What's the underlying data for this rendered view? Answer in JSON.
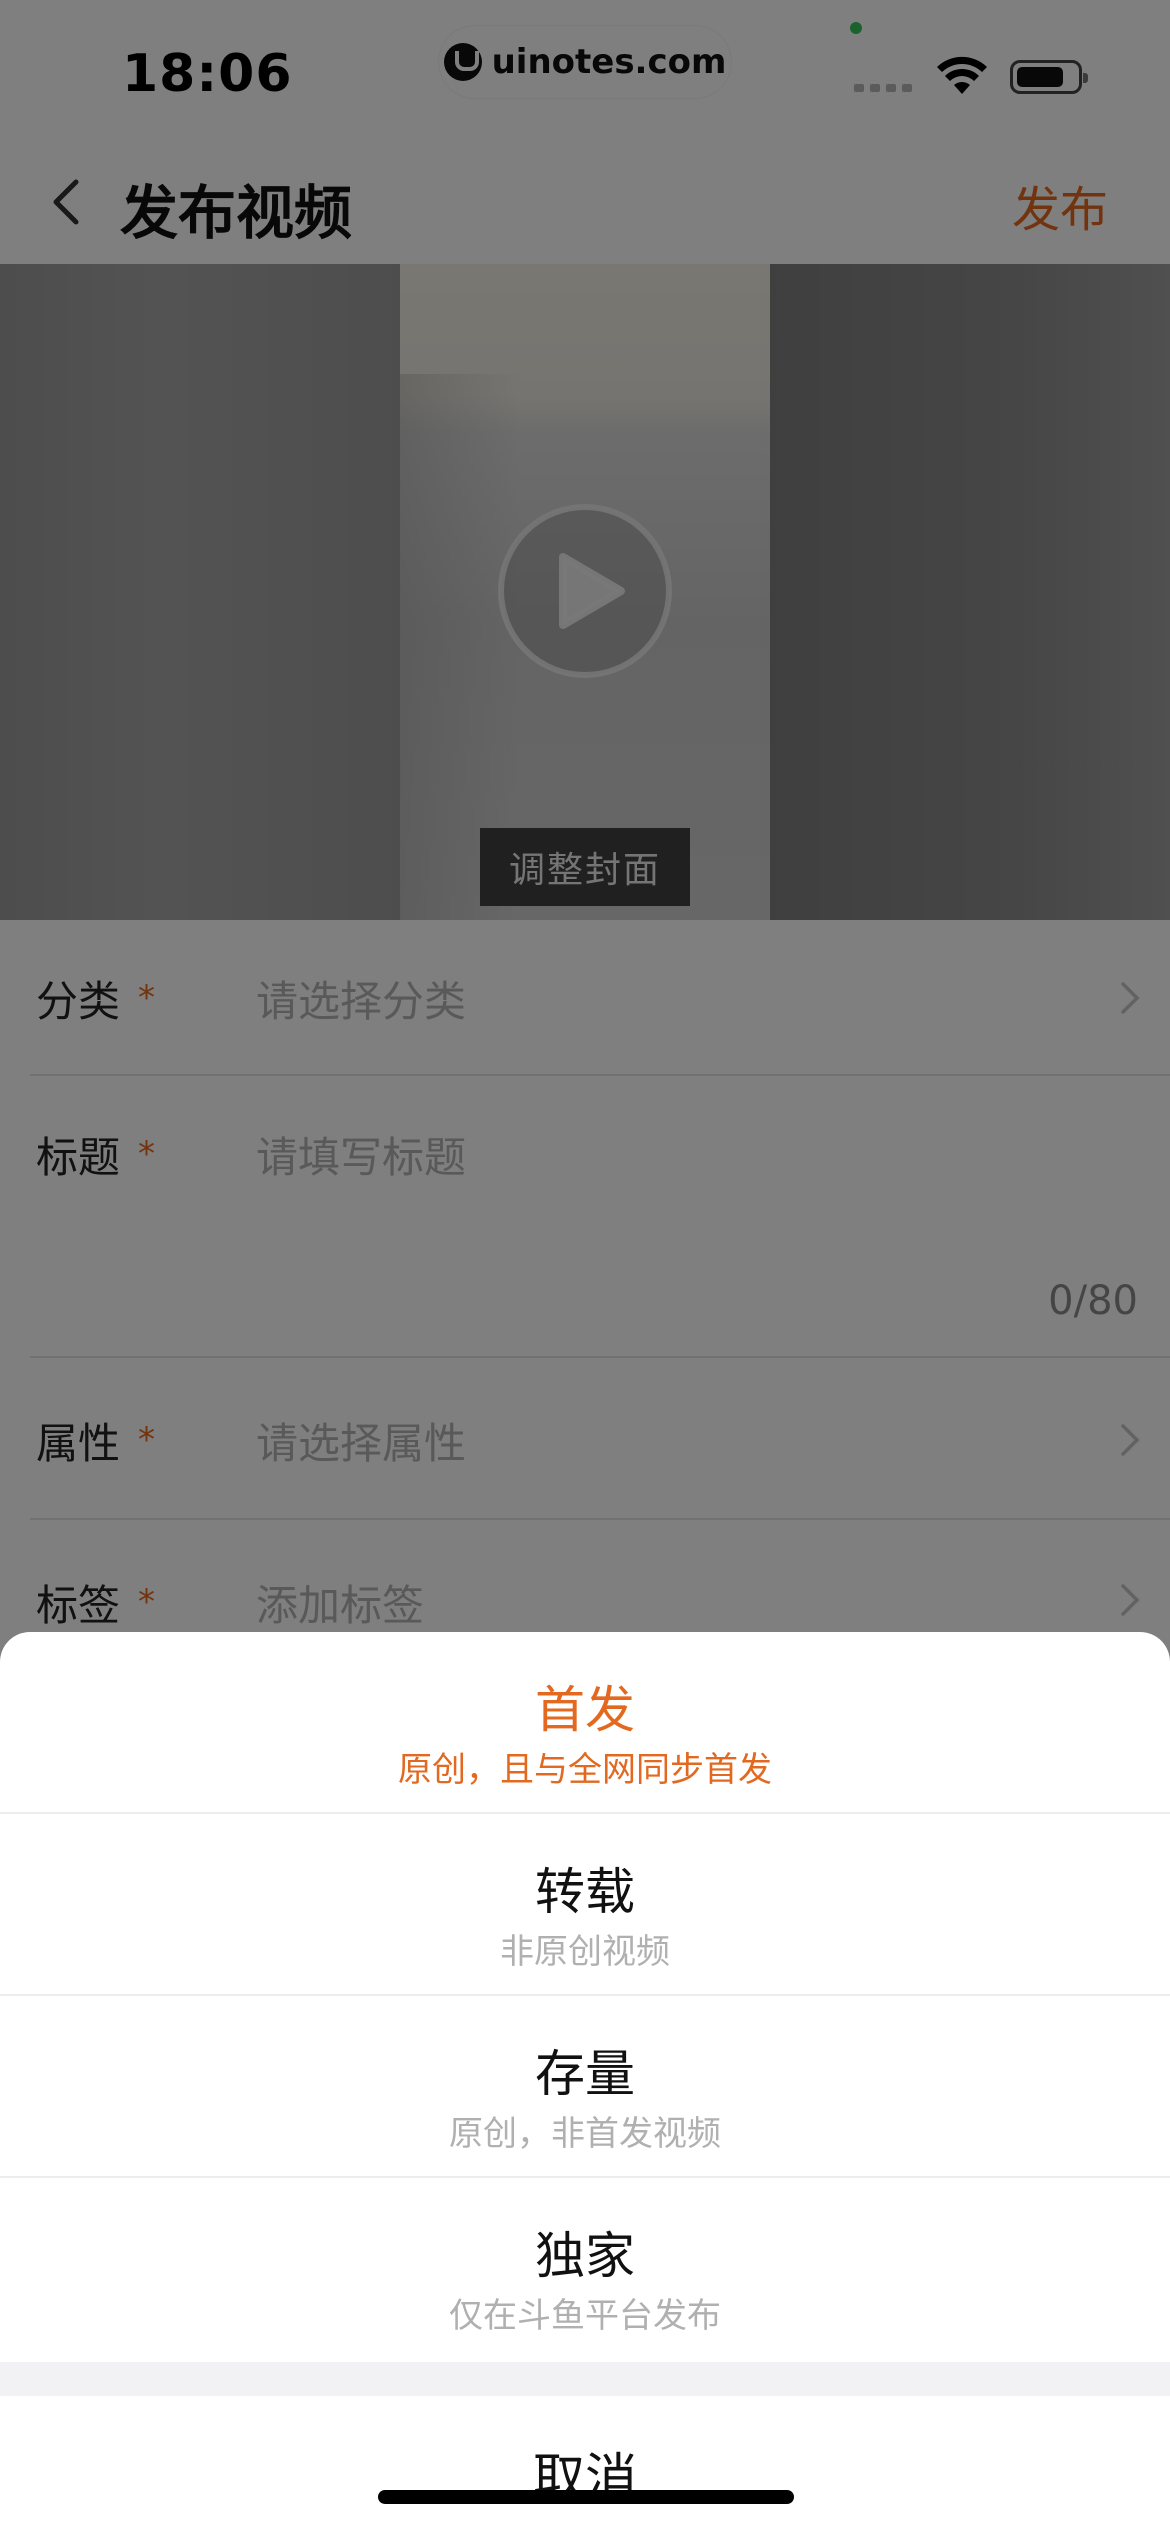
{
  "status_bar": {
    "time": "18:06",
    "watermark": "uinotes.com"
  },
  "nav": {
    "title": "发布视频",
    "publish_label": "发布"
  },
  "video": {
    "cover_button_label": "调整封面"
  },
  "form": {
    "rows": [
      {
        "label": "分类",
        "required_mark": "*",
        "placeholder": "请选择分类"
      },
      {
        "label": "标题",
        "required_mark": "*",
        "placeholder": "请填写标题",
        "counter": "0/80"
      },
      {
        "label": "属性",
        "required_mark": "*",
        "placeholder": "请选择属性"
      },
      {
        "label": "标签",
        "required_mark": "*",
        "placeholder": "添加标签"
      }
    ]
  },
  "sheet": {
    "options": [
      {
        "title": "首发",
        "subtitle": "原创，且与全网同步首发",
        "selected": true
      },
      {
        "title": "转载",
        "subtitle": "非原创视频",
        "selected": false
      },
      {
        "title": "存量",
        "subtitle": "原创，非首发视频",
        "selected": false
      },
      {
        "title": "独家",
        "subtitle": "仅在斗鱼平台发布",
        "selected": false
      }
    ],
    "cancel_label": "取消"
  },
  "colors": {
    "accent": "#e2691f",
    "overlay": "rgba(0,0,0,0.5)"
  }
}
